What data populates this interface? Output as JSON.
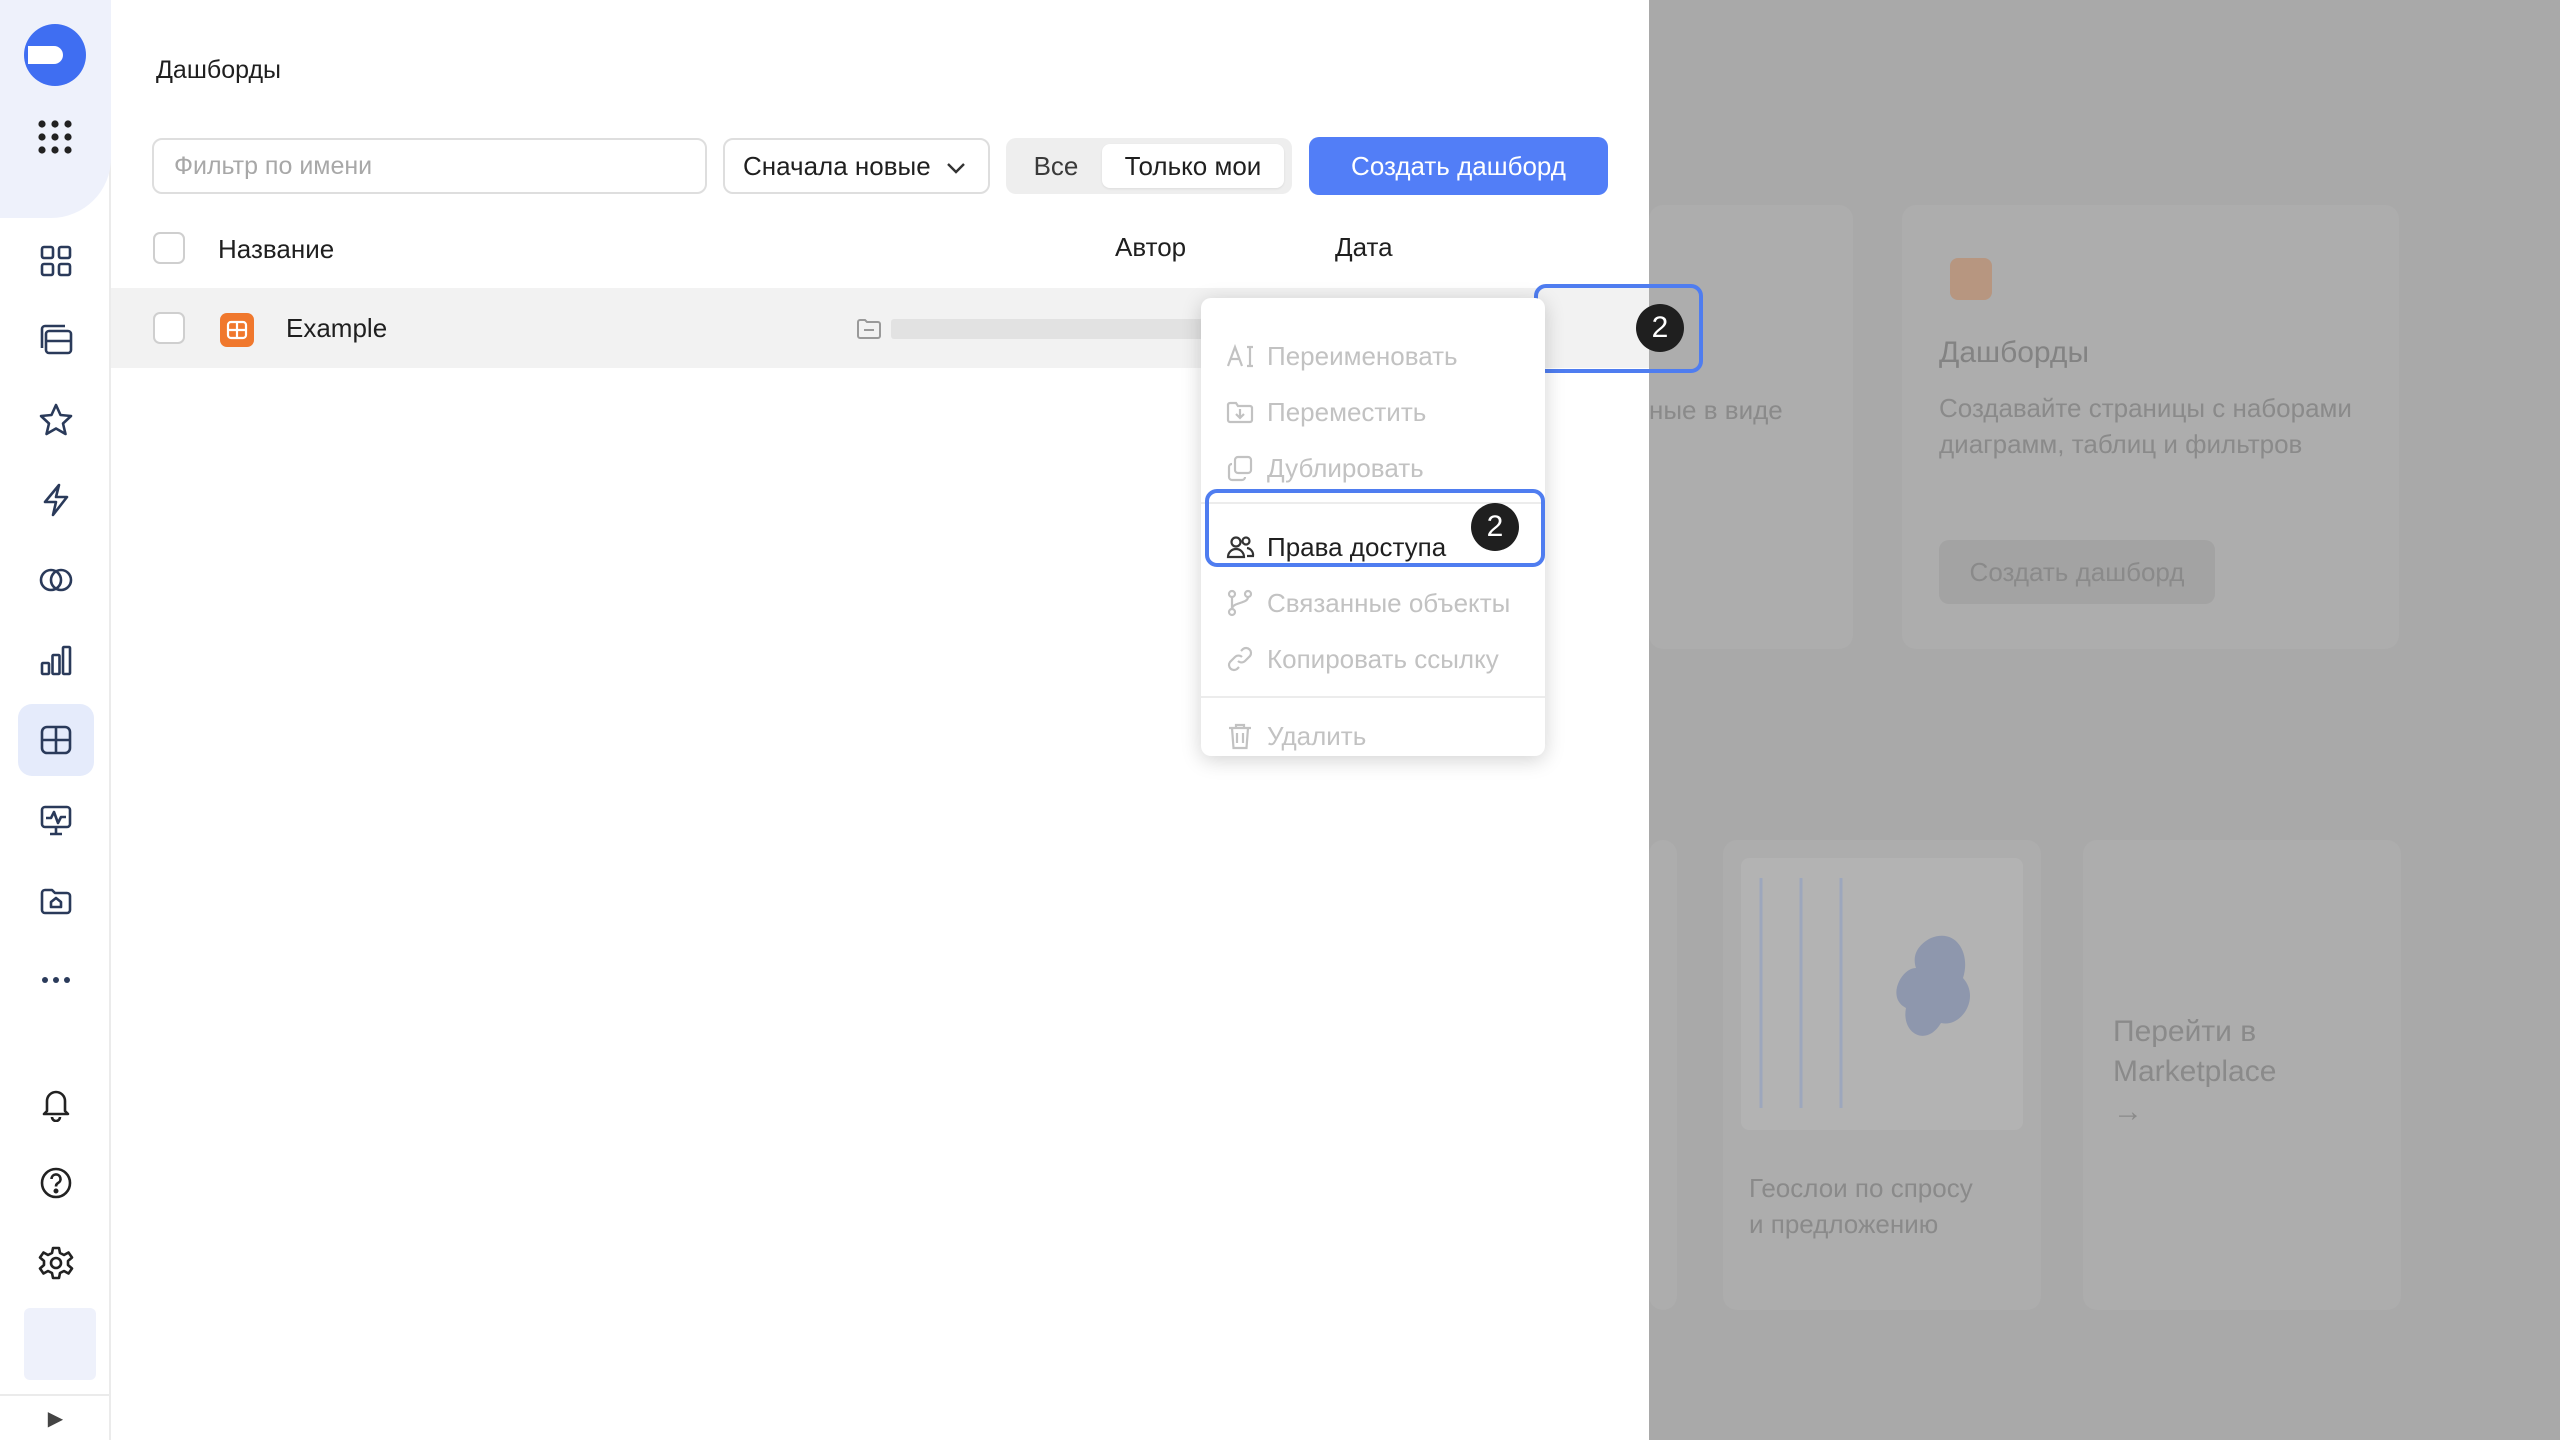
{
  "page": {
    "title": "Дашборды"
  },
  "toolbar": {
    "filter_placeholder": "Фильтр по имени",
    "sort_value": "Сначала новые",
    "seg_all": "Все",
    "seg_mine": "Только мои",
    "create_label": "Создать дашборд"
  },
  "table": {
    "columns": {
      "name": "Название",
      "author": "Автор",
      "date": "Дата"
    },
    "rows": [
      {
        "name": "Example"
      }
    ]
  },
  "menu": {
    "rename": "Переименовать",
    "move": "Переместить",
    "duplicate": "Дублировать",
    "access": "Права доступа",
    "related": "Связанные объекты",
    "copy_link": "Копировать ссылку",
    "delete": "Удалить"
  },
  "badges": {
    "step": "2"
  },
  "background": {
    "card_title": "Дашборды",
    "card_desc_line1": "Создавайте страницы с наборами",
    "card_desc_line2": "диаграмм, таблиц и фильтров",
    "card_button": "Создать дашборд",
    "partial_text": "ные в виде",
    "geo_line1": "Геослои по спросу",
    "geo_line2": "и предложению",
    "market_line1": "Перейти в",
    "market_line2": "Marketplace",
    "market_arrow": "→"
  },
  "rail": {
    "collapse_icon": "▶"
  },
  "colors": {
    "accent": "#527ef7",
    "highlight": "#4f7df0",
    "orange": "#f0782d"
  }
}
